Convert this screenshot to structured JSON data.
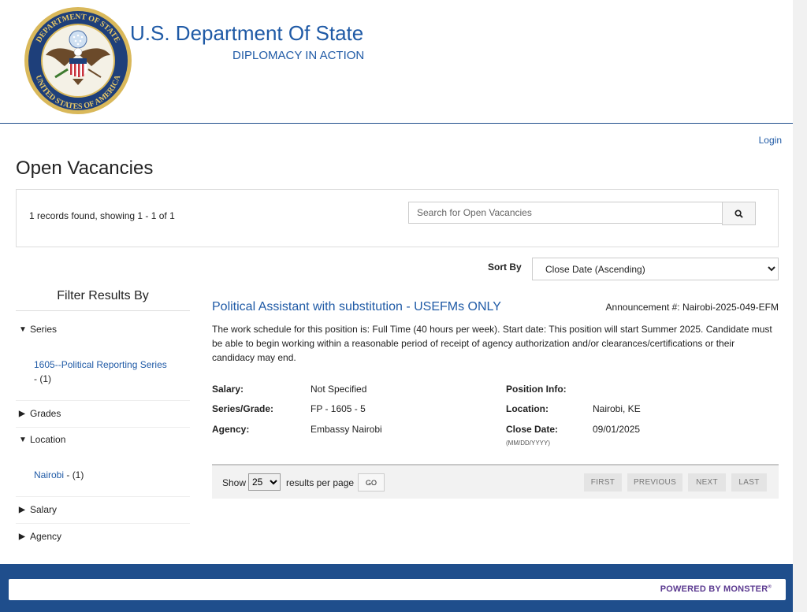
{
  "header": {
    "seal_text_top": "DEPARTMENT OF STATE",
    "seal_text_bottom": "UNITED STATES OF AMERICA",
    "title": "U.S. Department Of State",
    "tagline": "DIPLOMACY IN ACTION"
  },
  "login_label": "Login",
  "page_title": "Open Vacancies",
  "results": {
    "records_text": "1 records found, showing 1 - 1 of 1"
  },
  "search": {
    "placeholder": "Search for Open Vacancies",
    "button_icon": "search-icon"
  },
  "sort": {
    "label": "Sort By",
    "selected": "Close Date (Ascending)"
  },
  "filter": {
    "title": "Filter Results By",
    "facets": [
      {
        "label": "Series",
        "expanded": true,
        "values": [
          {
            "name": "1605--Political Reporting Series",
            "count": "- (1)"
          }
        ]
      },
      {
        "label": "Grades",
        "expanded": false
      },
      {
        "label": "Location",
        "expanded": true,
        "values": [
          {
            "name": "Nairobi",
            "count": "- (1)"
          }
        ]
      },
      {
        "label": "Salary",
        "expanded": false
      },
      {
        "label": "Agency",
        "expanded": false
      }
    ]
  },
  "job": {
    "title": "Political Assistant with substitution - USEFMs ONLY",
    "announcement": "Announcement #: Nairobi-2025-049-EFM",
    "description": "The work schedule for this position is: Full Time (40 hours per week). Start date: This position will start Summer 2025. Candidate must be able to begin working within a reasonable period of receipt of agency authorization and/or clearances/certifications or their candidacy may end.",
    "salary_label": "Salary:",
    "salary": "Not Specified",
    "series_grade_label": "Series/Grade:",
    "series_grade": "FP - 1605 - 5",
    "agency_label": "Agency:",
    "agency": "Embassy Nairobi",
    "position_info_label": "Position Info:",
    "location_label": "Location:",
    "location": "Nairobi, KE",
    "close_date_label": "Close Date:",
    "close_date": "09/01/2025",
    "close_date_format": "(MM/DD/YYYY)"
  },
  "pager": {
    "show_label": "Show",
    "per_page": "25",
    "per_page_suffix": "results per page",
    "go_label": "GO",
    "first": "FIRST",
    "previous": "PREVIOUS",
    "next": "NEXT",
    "last": "LAST"
  },
  "footer": {
    "powered_by": "POWERED BY MONSTER"
  },
  "colors": {
    "brand_blue": "#1f5aa6",
    "footer_blue": "#1f4e8c",
    "monster_purple": "#5b3a90"
  }
}
